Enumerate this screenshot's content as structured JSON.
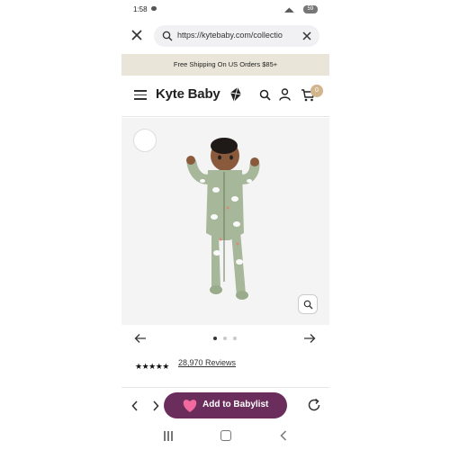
{
  "status_bar": {
    "time": "1:58",
    "battery": "59"
  },
  "browser": {
    "url": "https://kytebaby.com/collectio"
  },
  "promo": {
    "text": "Free Shipping On US Orders $85+"
  },
  "header": {
    "logo": "Kyte Baby",
    "cart_count": "0"
  },
  "product": {
    "image_count": 3,
    "active_image": 1,
    "rating_stars": "★★★★★",
    "rating_value": 5,
    "reviews_text": "28,970 Reviews"
  },
  "toolbar": {
    "babylist_label": "Add to Babylist"
  },
  "colors": {
    "promo_bg": "#e9e5d8",
    "cart_badge": "#d2b58b",
    "babylist_button": "#6b2d5c",
    "babylist_heart": "#f06aa0",
    "onesie_green": "#a7b799"
  },
  "icons": {
    "close": "close-icon",
    "search": "search-icon",
    "clear": "clear-icon",
    "menu": "hamburger-menu-icon",
    "account": "account-icon",
    "cart": "cart-icon",
    "zoom": "zoom-icon",
    "prev": "arrow-left-icon",
    "next": "arrow-right-icon",
    "back": "chevron-left-icon",
    "forward": "chevron-right-icon",
    "refresh": "refresh-icon",
    "heart": "heart-icon"
  }
}
